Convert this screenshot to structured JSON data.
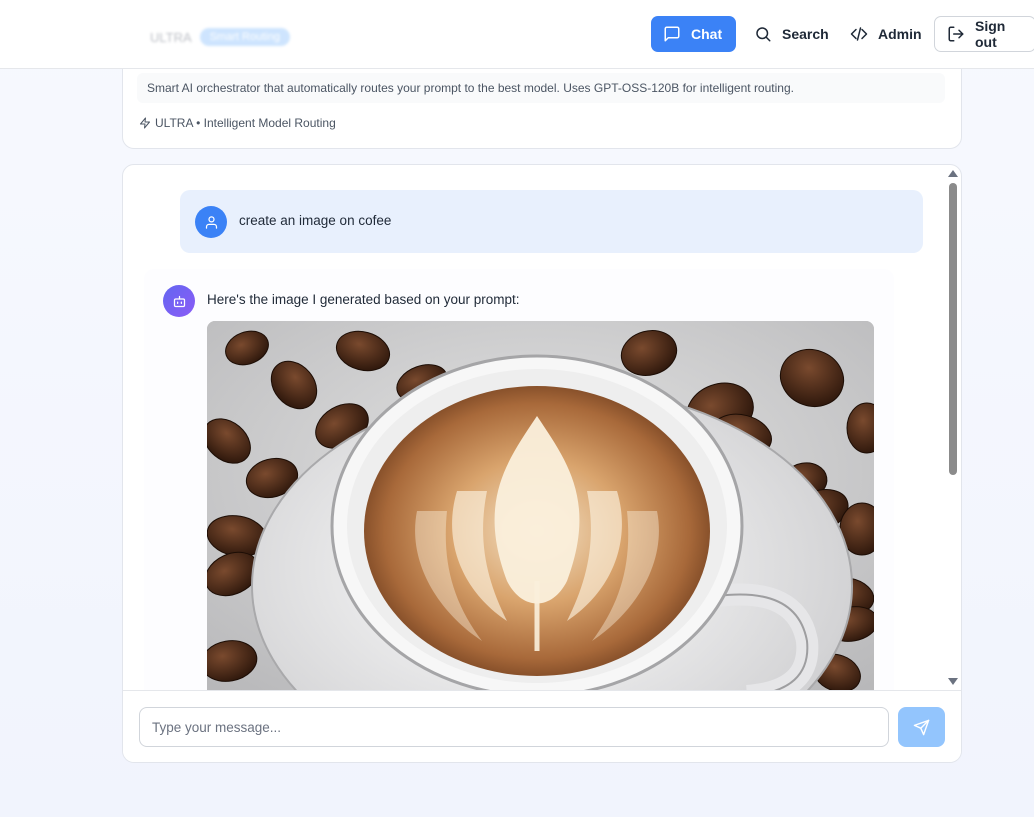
{
  "header": {
    "faded_label": "ULTRA",
    "faded_badge": "Smart Routing",
    "nav": {
      "chat": "Chat",
      "search": "Search",
      "admin": "Admin",
      "sign_out": "Sign out"
    }
  },
  "model_info": {
    "description": "Smart AI orchestrator that automatically routes your prompt to the best model. Uses GPT-OSS-120B for intelligent routing.",
    "meta": "ULTRA • Intelligent Model Routing"
  },
  "messages": [
    {
      "role": "user",
      "text": "create an image on cofee"
    },
    {
      "role": "assistant",
      "text": "Here's the image I generated based on your prompt:",
      "image": "latte-art-coffee-cup-with-beans"
    }
  ],
  "composer": {
    "placeholder": "Type your message..."
  },
  "colors": {
    "accent": "#3b82f6",
    "send_disabled": "#93c5fd",
    "user_bubble": "#e8f0fd"
  },
  "icons": {
    "chat": "message-square-icon",
    "search": "search-icon",
    "admin": "code-icon",
    "sign_out": "log-out-icon",
    "user": "user-icon",
    "bot": "bot-icon",
    "meta": "zap-icon",
    "send": "send-icon"
  }
}
